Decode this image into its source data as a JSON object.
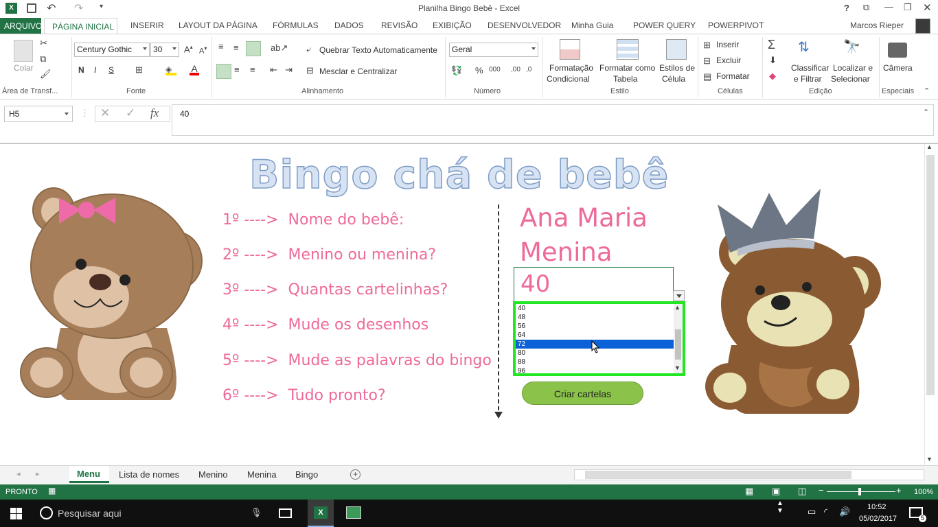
{
  "window": {
    "title": "Planilha Bingo Bebê - Excel",
    "user": "Marcos Rieper"
  },
  "ribbon_tabs": [
    "ARQUIVO",
    "PÁGINA INICIAL",
    "INSERIR",
    "LAYOUT DA PÁGINA",
    "FÓRMULAS",
    "DADOS",
    "REVISÃO",
    "EXIBIÇÃO",
    "DESENVOLVEDOR",
    "Minha Guia",
    "POWER QUERY",
    "POWERPIVOT"
  ],
  "ribbon": {
    "paste": "Colar",
    "clipboard_group": "Área de Transf...",
    "font_name": "Century Gothic",
    "font_size": "30",
    "bold": "N",
    "italic": "I",
    "underline": "S",
    "font_group": "Fonte",
    "wrap_text": "Quebrar Texto Automaticamente",
    "merge_center": "Mesclar e Centralizar",
    "align_group": "Alinhamento",
    "number_format": "Geral",
    "number_group": "Número",
    "cond_format": "Formatação",
    "cond_format2": "Condicional",
    "format_table": "Formatar como",
    "format_table2": "Tabela",
    "cell_styles": "Estilos de",
    "cell_styles2": "Célula",
    "style_group": "Estilo",
    "insert": "Inserir",
    "delete": "Excluir",
    "format": "Formatar",
    "cells_group": "Células",
    "sort_filter": "Classificar",
    "sort_filter2": "e Filtrar",
    "find_select": "Localizar e",
    "find_select2": "Selecionar",
    "edit_group": "Edição",
    "camera": "Câmera",
    "special_group": "Especiais"
  },
  "formula_bar": {
    "cell_ref": "H5",
    "fx": "fx",
    "value": "40"
  },
  "sheet": {
    "title": "Bingo chá de bebê",
    "steps": [
      {
        "num": "1º ---->",
        "text": "Nome do bebê:"
      },
      {
        "num": "2º ---->",
        "text": "Menino ou menina?"
      },
      {
        "num": "3º ---->",
        "text": "Quantas cartelinhas?"
      },
      {
        "num": "4º ---->",
        "text": "Mude os desenhos"
      },
      {
        "num": "5º ---->",
        "text": "Mude as palavras do bingo"
      },
      {
        "num": "6º ---->",
        "text": "Tudo pronto?"
      }
    ],
    "baby_name": "Ana Maria",
    "gender": "Menina",
    "cards": "40",
    "dropdown_options": [
      "40",
      "48",
      "56",
      "64",
      "72",
      "80",
      "88",
      "96"
    ],
    "dropdown_selected": "72",
    "create_button": "Criar cartelas"
  },
  "sheet_tabs": [
    "Menu",
    "Lista de nomes",
    "Menino",
    "Menina",
    "Bingo"
  ],
  "status": {
    "ready": "PRONTO",
    "zoom": "100%"
  },
  "taskbar": {
    "search": "Pesquisar aqui",
    "time": "10:52",
    "date": "05/02/2017",
    "notifications": "5"
  },
  "colors": {
    "excel_green": "#217346",
    "pink": "#ee6a9a",
    "highlight_green": "#22e622",
    "selection_blue": "#0a62d6"
  }
}
